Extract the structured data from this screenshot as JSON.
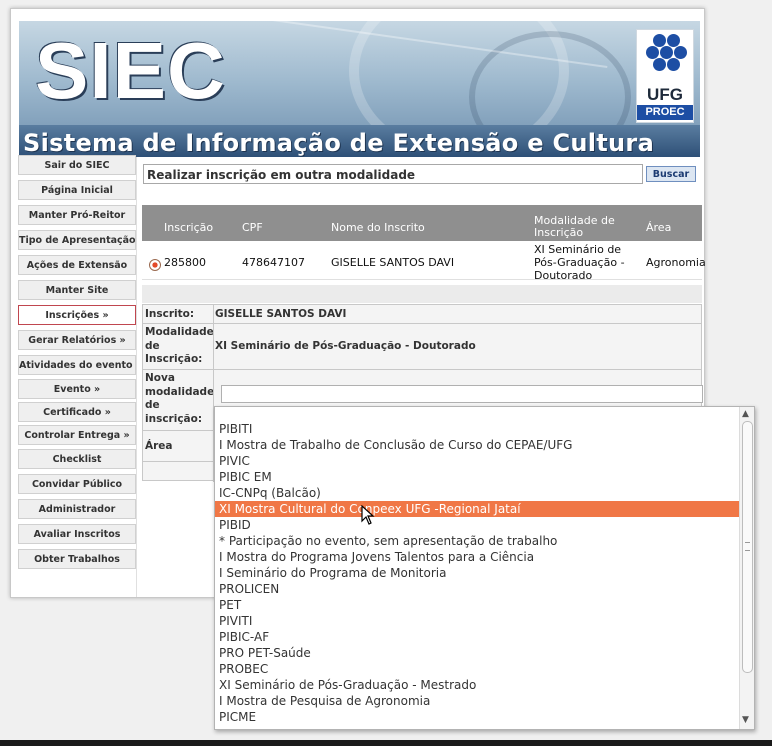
{
  "banner": {
    "title": "SIEC",
    "subtitle": "Sistema de Informação de Extensão e Cultura",
    "logo_text": "UFG",
    "logo_subtext": "PROEC",
    "logo_color": "#1d4ea4"
  },
  "sidebar": {
    "items": [
      {
        "label": "Sair do SIEC"
      },
      {
        "label": "Página Inicial"
      },
      {
        "label": "Manter Pró-Reitor"
      },
      {
        "label": "Tipo de Apresentação"
      },
      {
        "label": "Ações de Extensão"
      },
      {
        "label": "Manter Site"
      },
      {
        "label": "Inscrições   »"
      },
      {
        "label": "Gerar Relatórios  »"
      },
      {
        "label": "Atividades do evento »"
      },
      {
        "label": "Evento   »"
      },
      {
        "label": "Certificado   »"
      },
      {
        "label": "Controlar Entrega   »"
      },
      {
        "label": "Checklist"
      },
      {
        "label": "Convidar Público"
      },
      {
        "label": "Administrador"
      },
      {
        "label": "Avaliar Inscritos"
      },
      {
        "label": "Obter Trabalhos"
      }
    ],
    "active_index": 6
  },
  "search": {
    "value": "Realizar inscrição em outra modalidade",
    "button_label": "Buscar"
  },
  "results": {
    "headers": {
      "inscricao": "Inscrição",
      "cpf": "CPF",
      "nome": "Nome do Inscrito",
      "modalidade": "Modalidade de Inscrição",
      "area": "Área"
    },
    "row": {
      "inscricao": "285800",
      "cpf": "478647107",
      "nome": "GISELLE SANTOS DAVI",
      "modalidade": "XI Seminário de Pós-Graduação - Doutorado",
      "area": "Agronomia"
    }
  },
  "form": {
    "inscrito_label": "Inscrito:",
    "inscrito_value": "GISELLE SANTOS DAVI",
    "modalidade_label": "Modalidade de Inscrição:",
    "modalidade_value": "XI Seminário de Pós-Graduação - Doutorado",
    "nova_label": "Nova modalidade de inscrição:",
    "area_label": "Área"
  },
  "dropdown": {
    "options": [
      "",
      "PIBITI",
      "I Mostra de Trabalho de Conclusão de Curso do CEPAE/UFG",
      "PIVIC",
      "PIBIC EM",
      "IC-CNPq (Balcão)",
      "XI Mostra Cultural do Conpeex UFG -Regional Jataí",
      "PIBID",
      "* Participação no evento, sem apresentação de trabalho",
      "I Mostra do Programa Jovens Talentos para a Ciência",
      "I Seminário do Programa de Monitoria",
      "PROLICEN",
      "PET",
      "PIVITI",
      "PIBIC-AF",
      "PRO PET-Saúde",
      "PROBEC",
      "XI Seminário de Pós-Graduação - Mestrado",
      "I Mostra de Pesquisa de Agronomia",
      "PICME"
    ],
    "selected_index": 6,
    "highlight_color": "#f07746"
  }
}
